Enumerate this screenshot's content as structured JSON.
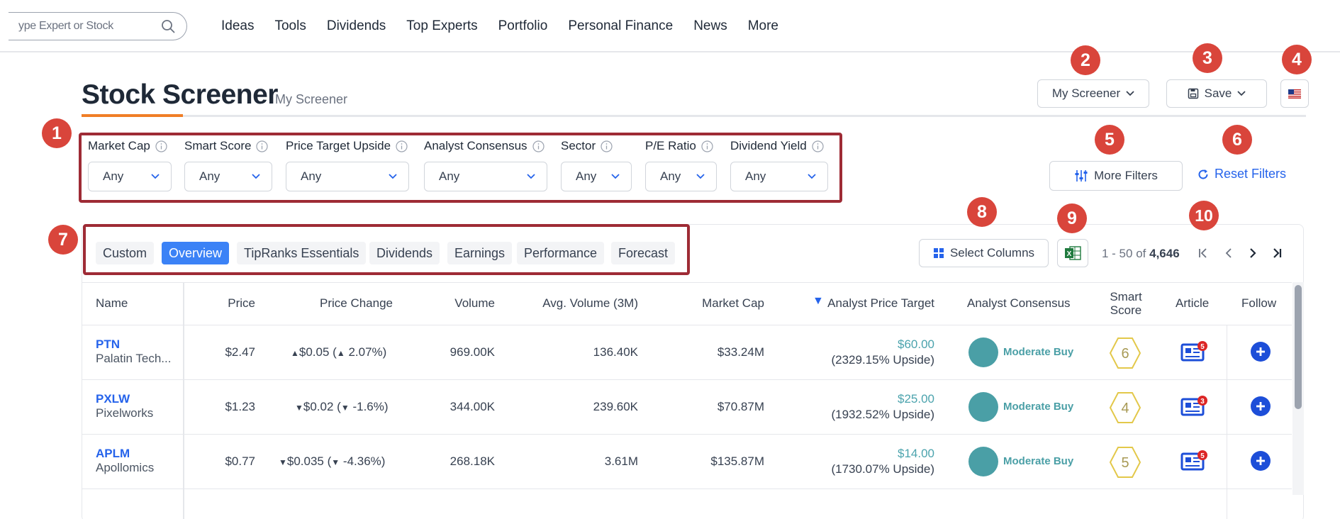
{
  "nav": {
    "search_placeholder": "ype Expert or Stock",
    "links": [
      "Ideas",
      "Tools",
      "Dividends",
      "Top Experts",
      "Portfolio",
      "Personal Finance",
      "News",
      "More"
    ]
  },
  "header": {
    "title": "Stock Screener",
    "subtitle": "My Screener",
    "my_screener_label": "My Screener",
    "save_label": "Save"
  },
  "filters": [
    {
      "label": "Market Cap",
      "value": "Any"
    },
    {
      "label": "Smart Score",
      "value": "Any"
    },
    {
      "label": "Price Target Upside",
      "value": "Any"
    },
    {
      "label": "Analyst Consensus",
      "value": "Any"
    },
    {
      "label": "Sector",
      "value": "Any"
    },
    {
      "label": "P/E Ratio",
      "value": "Any"
    },
    {
      "label": "Dividend Yield",
      "value": "Any"
    }
  ],
  "more_filters_label": "More Filters",
  "reset_filters_label": "Reset Filters",
  "tabs": [
    {
      "label": "Custom",
      "active": false
    },
    {
      "label": "Overview",
      "active": true
    },
    {
      "label": "TipRanks Essentials",
      "active": false
    },
    {
      "label": "Dividends",
      "active": false
    },
    {
      "label": "Earnings",
      "active": false
    },
    {
      "label": "Performance",
      "active": false
    },
    {
      "label": "Forecast",
      "active": false
    }
  ],
  "select_columns_label": "Select Columns",
  "pagination": {
    "range": "1 - 50 of",
    "total": "4,646"
  },
  "columns": [
    "Name",
    "Price",
    "Price Change",
    "Volume",
    "Avg. Volume (3M)",
    "Market Cap",
    "Analyst Price Target",
    "Analyst Consensus",
    "Smart Score",
    "Article",
    "Follow"
  ],
  "sort_indicator": "▼",
  "rows": [
    {
      "ticker": "PTN",
      "company": "Palatin Tech...",
      "price": "$2.47",
      "change_amt": "$0.05",
      "change_pct": "2.07%",
      "direction": "up",
      "volume": "969.00K",
      "avg_volume": "136.40K",
      "market_cap": "$33.24M",
      "target": "$60.00",
      "upside": "(2329.15% Upside)",
      "consensus": "Moderate Buy",
      "smart_score": "6",
      "articles": "5"
    },
    {
      "ticker": "PXLW",
      "company": "Pixelworks",
      "price": "$1.23",
      "change_amt": "$0.02",
      "change_pct": "-1.6%",
      "direction": "down",
      "volume": "344.00K",
      "avg_volume": "239.60K",
      "market_cap": "$70.87M",
      "target": "$25.00",
      "upside": "(1932.52% Upside)",
      "consensus": "Moderate Buy",
      "smart_score": "4",
      "articles": "3"
    },
    {
      "ticker": "APLM",
      "company": "Apollomics",
      "price": "$0.77",
      "change_amt": "$0.035",
      "change_pct": "-4.36%",
      "direction": "down",
      "volume": "268.18K",
      "avg_volume": "3.61M",
      "market_cap": "$135.87M",
      "target": "$14.00",
      "upside": "(1730.07% Upside)",
      "consensus": "Moderate Buy",
      "smart_score": "5",
      "articles": "5"
    }
  ],
  "annotations": [
    "1",
    "2",
    "3",
    "4",
    "5",
    "6",
    "7",
    "8",
    "9",
    "10"
  ],
  "colors": {
    "accent": "#3b82f6",
    "brand_underline": "#f07e26",
    "annotation": "#d9453b",
    "highlight_box": "#9e2b35",
    "consensus": "#4a9fa6",
    "smart_score": "#e3c84a"
  }
}
